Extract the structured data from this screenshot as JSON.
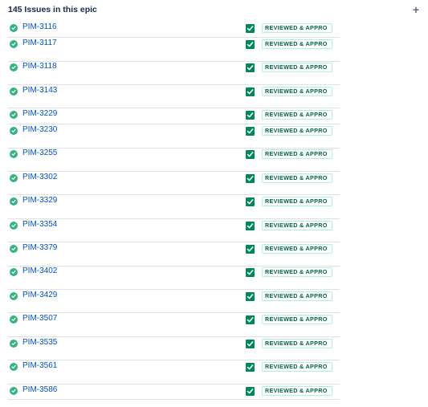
{
  "header": {
    "title": "145 Issues in this epic",
    "add_icon": "plus-icon",
    "add_symbol": "+"
  },
  "issues": [
    {
      "key": "PIM-3116",
      "status": "REVIEWED & APPRO"
    },
    {
      "key": "PIM-3117",
      "status": "REVIEWED & APPRO"
    },
    {
      "key": "PIM-3118",
      "status": "REVIEWED & APPRO"
    },
    {
      "key": "PIM-3143",
      "status": "REVIEWED & APPRO"
    },
    {
      "key": "PIM-3229",
      "status": "REVIEWED & APPRO"
    },
    {
      "key": "PIM-3230",
      "status": "REVIEWED & APPRO"
    },
    {
      "key": "PIM-3255",
      "status": "REVIEWED & APPRO"
    },
    {
      "key": "PIM-3302",
      "status": "REVIEWED & APPRO"
    },
    {
      "key": "PIM-3329",
      "status": "REVIEWED & APPRO"
    },
    {
      "key": "PIM-3354",
      "status": "REVIEWED & APPRO"
    },
    {
      "key": "PIM-3379",
      "status": "REVIEWED & APPRO"
    },
    {
      "key": "PIM-3402",
      "status": "REVIEWED & APPRO"
    },
    {
      "key": "PIM-3429",
      "status": "REVIEWED & APPRO"
    },
    {
      "key": "PIM-3507",
      "status": "REVIEWED & APPRO"
    },
    {
      "key": "PIM-3535",
      "status": "REVIEWED & APPRO"
    },
    {
      "key": "PIM-3561",
      "status": "REVIEWED & APPRO"
    },
    {
      "key": "PIM-3586",
      "status": "REVIEWED & APPRO"
    }
  ],
  "icons": {
    "issue_type": "check-circle-icon",
    "done_checkbox": "checkbox-checked-icon"
  },
  "colors": {
    "link": "#0052cc",
    "done_green": "#36b37e",
    "checkbox_green": "#00875a",
    "lozenge_text": "#006644",
    "lozenge_border": "#abf5d1"
  }
}
